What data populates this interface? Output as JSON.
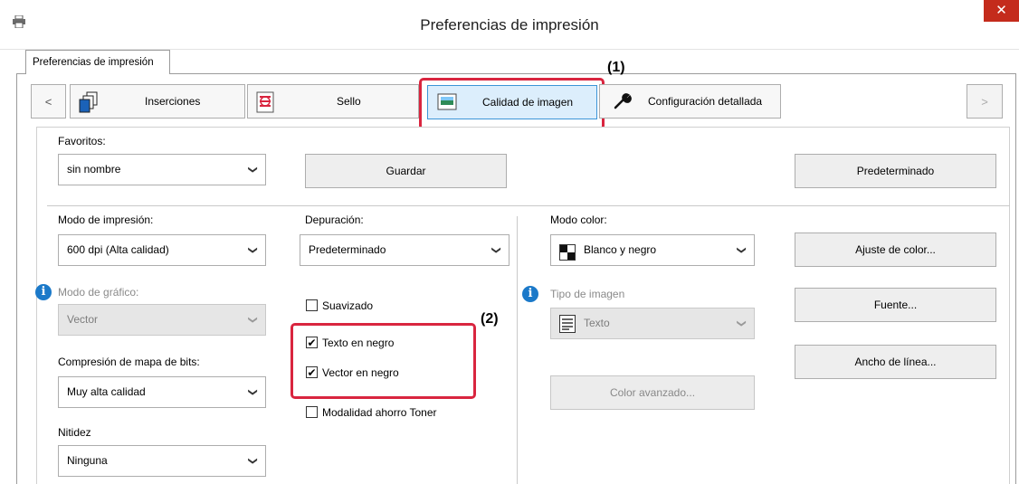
{
  "window": {
    "title": "Preferencias de impresión",
    "close_glyph": "✕"
  },
  "outer_tab": {
    "label": "Preferencias de impresión"
  },
  "tabstrip": {
    "prev": "<",
    "next": ">",
    "tabs": [
      {
        "label": "Inserciones",
        "icon": "inserts-icon"
      },
      {
        "label": "Sello",
        "icon": "stamp-icon"
      },
      {
        "label": "Calidad de imagen",
        "icon": "image-quality-icon"
      },
      {
        "label": "Configuración detallada",
        "icon": "wrench-icon"
      }
    ],
    "selected": "Calidad de imagen"
  },
  "annotations": {
    "a1": "(1)",
    "a2": "(2)"
  },
  "favorites": {
    "label": "Favoritos:",
    "value": "sin nombre",
    "save": "Guardar",
    "default": "Predeterminado"
  },
  "col1": {
    "print_mode_label": "Modo de impresión:",
    "print_mode_value": "600 dpi (Alta calidad)",
    "graphic_mode_label": "Modo de gráfico:",
    "graphic_mode_value": "Vector",
    "bitmap_label": "Compresión de mapa de bits:",
    "bitmap_value": "Muy alta calidad",
    "sharpness_label": "Nitidez",
    "sharpness_value": "Ninguna"
  },
  "col2": {
    "debug_label": "Depuración:",
    "debug_value": "Predeterminado",
    "smoothing": {
      "label": "Suavizado",
      "checked": false
    },
    "black_text": {
      "label": "Texto en negro",
      "checked": true
    },
    "black_vector": {
      "label": "Vector en negro",
      "checked": true
    },
    "toner_save": {
      "label": "Modalidad ahorro Toner",
      "checked": false
    }
  },
  "col3": {
    "color_mode_label": "Modo color:",
    "color_mode_value": "Blanco y negro",
    "image_type_label": "Tipo de imagen",
    "image_type_value": "Texto",
    "advanced_color": "Color avanzado..."
  },
  "col4": {
    "color_adjust": "Ajuste de color...",
    "font": "Fuente...",
    "line_width": "Ancho de línea..."
  },
  "colors": {
    "highlight": "#d9253f",
    "accent": "#1b79c9",
    "close": "#c42b1c"
  }
}
